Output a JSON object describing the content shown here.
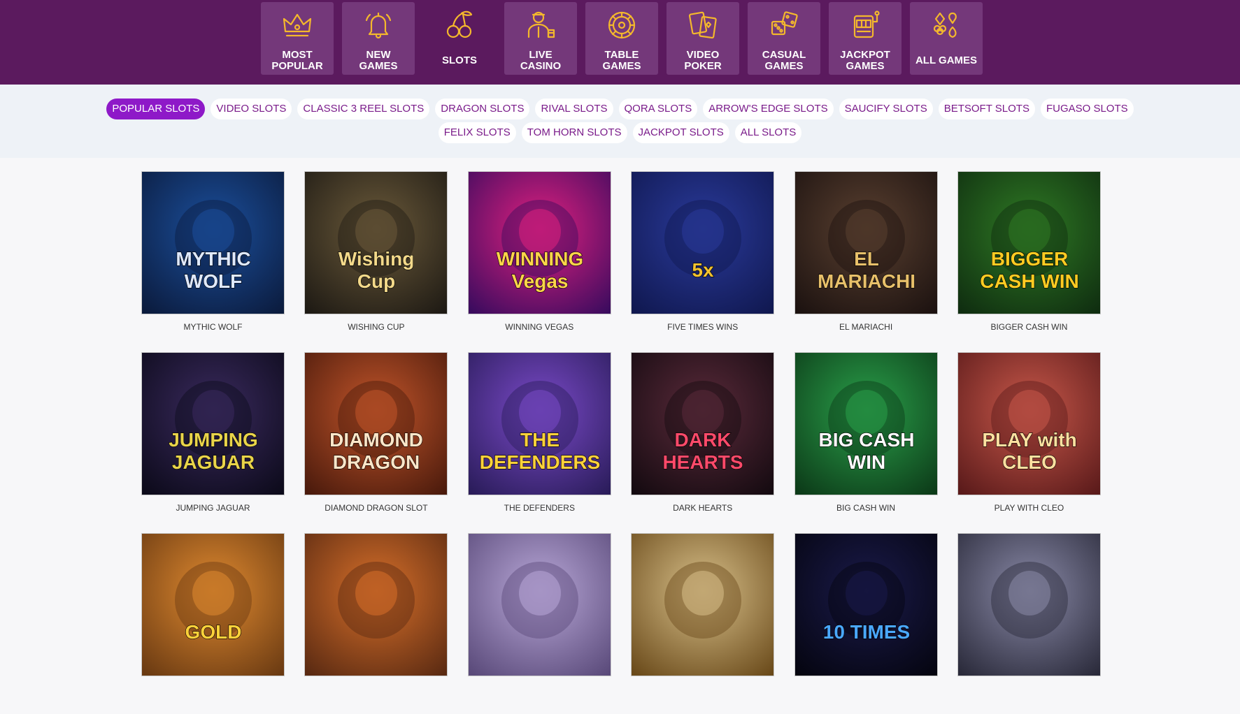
{
  "categories": [
    {
      "label": "MOST\nPOPULAR",
      "icon": "crown-icon",
      "active": false
    },
    {
      "label": "NEW\nGAMES",
      "icon": "bell-icon",
      "active": false
    },
    {
      "label": "SLOTS",
      "icon": "cherries-icon",
      "active": true
    },
    {
      "label": "LIVE\nCASINO",
      "icon": "dealer-icon",
      "active": false
    },
    {
      "label": "TABLE\nGAMES",
      "icon": "roulette-icon",
      "active": false
    },
    {
      "label": "VIDEO\nPOKER",
      "icon": "playing-cards-icon",
      "active": false
    },
    {
      "label": "CASUAL\nGAMES",
      "icon": "dice-icon",
      "active": false
    },
    {
      "label": "JACKPOT\nGAMES",
      "icon": "slot-machine-icon",
      "active": false
    },
    {
      "label": "ALL GAMES",
      "icon": "card-suits-icon",
      "active": false
    }
  ],
  "subnav": {
    "row1": [
      "POPULAR SLOTS",
      "VIDEO SLOTS",
      "CLASSIC 3 REEL SLOTS",
      "DRAGON SLOTS",
      "RIVAL SLOTS",
      "QORA SLOTS",
      "ARROW'S EDGE SLOTS",
      "SAUCIFY SLOTS",
      "BETSOFT SLOTS",
      "FUGASO SLOTS"
    ],
    "row2": [
      "FELIX SLOTS",
      "TOM HORN SLOTS",
      "JACKPOT SLOTS",
      "ALL SLOTS"
    ],
    "active": "POPULAR SLOTS"
  },
  "games": [
    {
      "name": "MYTHIC WOLF",
      "art": "MYTHIC WOLF",
      "bg1": "#1b4f9c",
      "bg2": "#0b1b3d",
      "fg": "#dfe9ff"
    },
    {
      "name": "WISHING CUP",
      "art": "Wishing Cup",
      "bg1": "#6b5a3a",
      "bg2": "#1e1a14",
      "fg": "#f3d98a"
    },
    {
      "name": "WINNING VEGAS",
      "art": "WINNING Vegas",
      "bg1": "#e0207f",
      "bg2": "#3a0b5e",
      "fg": "#ffd54a"
    },
    {
      "name": "FIVE TIMES WINS",
      "art": "5x",
      "bg1": "#2a3a9a",
      "bg2": "#101850",
      "fg": "#f2c230"
    },
    {
      "name": "EL MARIACHI",
      "art": "EL MARIACHI",
      "bg1": "#5a4030",
      "bg2": "#1c1210",
      "fg": "#e8c06a"
    },
    {
      "name": "BIGGER CASH WIN",
      "art": "BIGGER CASH WIN",
      "bg1": "#2f7a24",
      "bg2": "#0f2d10",
      "fg": "#ffcc22"
    },
    {
      "name": "JUMPING JAGUAR",
      "art": "JUMPING JAGUAR",
      "bg1": "#3a2a5e",
      "bg2": "#0c0a1a",
      "fg": "#e9d44a"
    },
    {
      "name": "DIAMOND DRAGON SLOT",
      "art": "DIAMOND DRAGON",
      "bg1": "#c2552a",
      "bg2": "#4a1a0c",
      "fg": "#ffe7c9"
    },
    {
      "name": "THE DEFENDERS",
      "art": "THE DEFENDERS",
      "bg1": "#7a4ac8",
      "bg2": "#2a1c5a",
      "fg": "#ffd23a"
    },
    {
      "name": "DARK HEARTS",
      "art": "DARK HEARTS",
      "bg1": "#5a2a3a",
      "bg2": "#140a10",
      "fg": "#ff4a6a"
    },
    {
      "name": "BIG CASH WIN",
      "art": "BIG CASH WIN",
      "bg1": "#2aa04a",
      "bg2": "#0c3a18",
      "fg": "#ffffff"
    },
    {
      "name": "PLAY WITH CLEO",
      "art": "PLAY with CLEO",
      "bg1": "#c8584a",
      "bg2": "#5a1a1a",
      "fg": "#ffe0a0"
    },
    {
      "name": "",
      "art": "GOLD",
      "bg1": "#e08a30",
      "bg2": "#6a3a12",
      "fg": "#ffd23a"
    },
    {
      "name": "",
      "art": "",
      "bg1": "#d8702a",
      "bg2": "#5a2a12",
      "fg": "#ffffff"
    },
    {
      "name": "",
      "art": "",
      "bg1": "#b9a8d8",
      "bg2": "#5a4a7a",
      "fg": "#ffffff"
    },
    {
      "name": "",
      "art": "",
      "bg1": "#d8c08a",
      "bg2": "#6a4a1a",
      "fg": "#ffffff"
    },
    {
      "name": "",
      "art": "10 TIMES",
      "bg1": "#1a1a4a",
      "bg2": "#050510",
      "fg": "#4aa8ff"
    },
    {
      "name": "",
      "art": "",
      "bg1": "#8a8aa8",
      "bg2": "#2a2a3a",
      "fg": "#ffffff"
    }
  ],
  "colors": {
    "topbar": "#5b1a5e",
    "tile": "#74387a",
    "accent": "#8e19c8",
    "icon": "#f4b82c"
  }
}
